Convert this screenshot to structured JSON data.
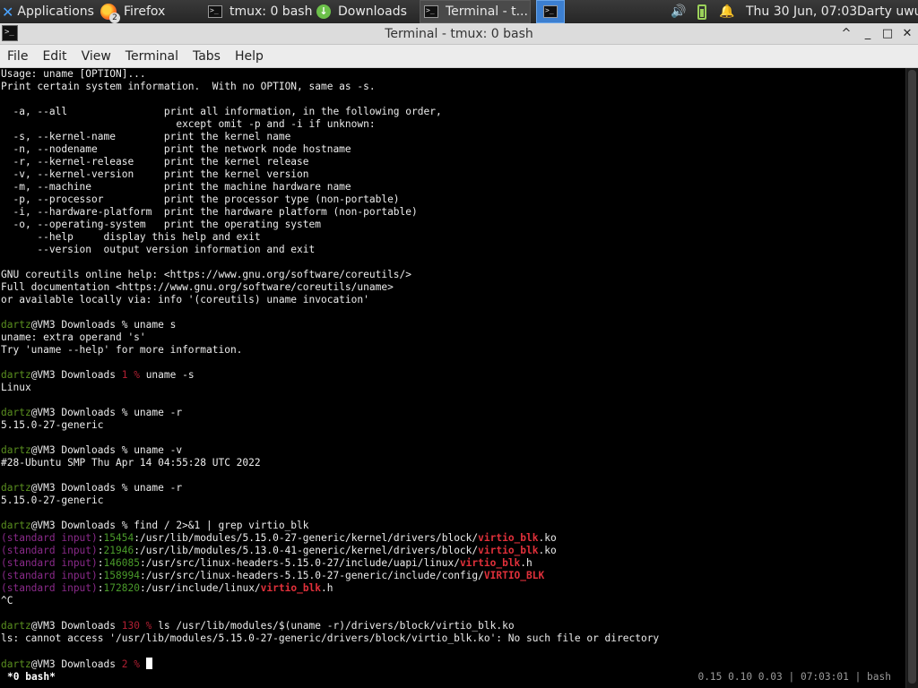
{
  "taskbar": {
    "applications": "Applications",
    "tasks": [
      {
        "label": "Firefox",
        "badge": "2"
      },
      {
        "label": "tmux: 0 bash"
      },
      {
        "label": "Downloads"
      },
      {
        "label": "Terminal - t..."
      }
    ],
    "clock": "Thu 30 Jun, 07:03",
    "user": "Darty uwu"
  },
  "window": {
    "title": "Terminal - tmux: 0 bash",
    "controls": {
      "shade": "^",
      "minimize": "_",
      "maximize": "□",
      "close": "✕"
    }
  },
  "menu": [
    "File",
    "Edit",
    "View",
    "Terminal",
    "Tabs",
    "Help"
  ],
  "terminal": {
    "lines": [
      [
        {
          "t": "Usage: uname [OPTION]..."
        }
      ],
      [
        {
          "t": "Print certain system information.  With no OPTION, same as -s."
        }
      ],
      [],
      [
        {
          "t": "  -a, --all                print all information, in the following order,"
        }
      ],
      [
        {
          "t": "                             except omit -p and -i if unknown:"
        }
      ],
      [
        {
          "t": "  -s, --kernel-name        print the kernel name"
        }
      ],
      [
        {
          "t": "  -n, --nodename           print the network node hostname"
        }
      ],
      [
        {
          "t": "  -r, --kernel-release     print the kernel release"
        }
      ],
      [
        {
          "t": "  -v, --kernel-version     print the kernel version"
        }
      ],
      [
        {
          "t": "  -m, --machine            print the machine hardware name"
        }
      ],
      [
        {
          "t": "  -p, --processor          print the processor type (non-portable)"
        }
      ],
      [
        {
          "t": "  -i, --hardware-platform  print the hardware platform (non-portable)"
        }
      ],
      [
        {
          "t": "  -o, --operating-system   print the operating system"
        }
      ],
      [
        {
          "t": "      --help     display this help and exit"
        }
      ],
      [
        {
          "t": "      --version  output version information and exit"
        }
      ],
      [],
      [
        {
          "t": "GNU coreutils online help: <https://www.gnu.org/software/coreutils/>"
        }
      ],
      [
        {
          "t": "Full documentation <https://www.gnu.org/software/coreutils/uname>"
        }
      ],
      [
        {
          "t": "or available locally via: info '(coreutils) uname invocation'"
        }
      ],
      [],
      [
        {
          "t": "dartz",
          "c": "user"
        },
        {
          "t": "@VM3 Downloads % uname s"
        }
      ],
      [
        {
          "t": "uname: extra operand 's'"
        }
      ],
      [
        {
          "t": "Try 'uname --help' for more information."
        }
      ],
      [],
      [
        {
          "t": "dartz",
          "c": "user"
        },
        {
          "t": "@VM3 Downloads "
        },
        {
          "t": "1 %",
          "c": "err"
        },
        {
          "t": " uname -s"
        }
      ],
      [
        {
          "t": "Linux"
        }
      ],
      [],
      [
        {
          "t": "dartz",
          "c": "user"
        },
        {
          "t": "@VM3 Downloads % uname -r"
        }
      ],
      [
        {
          "t": "5.15.0-27-generic"
        }
      ],
      [],
      [
        {
          "t": "dartz",
          "c": "user"
        },
        {
          "t": "@VM3 Downloads % uname -v"
        }
      ],
      [
        {
          "t": "#28-Ubuntu SMP Thu Apr 14 04:55:28 UTC 2022"
        }
      ],
      [],
      [
        {
          "t": "dartz",
          "c": "user"
        },
        {
          "t": "@VM3 Downloads % uname -r"
        }
      ],
      [
        {
          "t": "5.15.0-27-generic"
        }
      ],
      [],
      [
        {
          "t": "dartz",
          "c": "user"
        },
        {
          "t": "@VM3 Downloads % find / 2>&1 | grep virtio_blk"
        }
      ],
      [
        {
          "t": "(standard input)",
          "c": "purp"
        },
        {
          "t": ":"
        },
        {
          "t": "15454",
          "c": "grn"
        },
        {
          "t": ":/usr/lib/modules/5.15.0-27-generic/kernel/drivers/block/"
        },
        {
          "t": "virtio_blk",
          "c": "red"
        },
        {
          "t": ".ko"
        }
      ],
      [
        {
          "t": "(standard input)",
          "c": "purp"
        },
        {
          "t": ":"
        },
        {
          "t": "21946",
          "c": "grn"
        },
        {
          "t": ":/usr/lib/modules/5.13.0-41-generic/kernel/drivers/block/"
        },
        {
          "t": "virtio_blk",
          "c": "red"
        },
        {
          "t": ".ko"
        }
      ],
      [
        {
          "t": "(standard input)",
          "c": "purp"
        },
        {
          "t": ":"
        },
        {
          "t": "146085",
          "c": "grn"
        },
        {
          "t": ":/usr/src/linux-headers-5.15.0-27/include/uapi/linux/"
        },
        {
          "t": "virtio_blk",
          "c": "red"
        },
        {
          "t": ".h"
        }
      ],
      [
        {
          "t": "(standard input)",
          "c": "purp"
        },
        {
          "t": ":"
        },
        {
          "t": "158994",
          "c": "grn"
        },
        {
          "t": ":/usr/src/linux-headers-5.15.0-27-generic/include/config/"
        },
        {
          "t": "VIRTIO_BLK",
          "c": "red"
        }
      ],
      [
        {
          "t": "(standard input)",
          "c": "purp"
        },
        {
          "t": ":"
        },
        {
          "t": "172820",
          "c": "grn"
        },
        {
          "t": ":/usr/include/linux/"
        },
        {
          "t": "virtio_blk",
          "c": "red"
        },
        {
          "t": ".h"
        }
      ],
      [
        {
          "t": "^C"
        }
      ],
      [],
      [
        {
          "t": "dartz",
          "c": "user"
        },
        {
          "t": "@VM3 Downloads "
        },
        {
          "t": "130 %",
          "c": "err"
        },
        {
          "t": " ls /usr/lib/modules/$(uname -r)/drivers/block/virtio_blk.ko"
        }
      ],
      [
        {
          "t": "ls: cannot access '/usr/lib/modules/5.15.0-27-generic/drivers/block/virtio_blk.ko': No such file or directory"
        }
      ],
      [],
      [
        {
          "t": "dartz",
          "c": "user"
        },
        {
          "t": "@VM3 Downloads "
        },
        {
          "t": "2 %",
          "c": "err"
        },
        {
          "t": " "
        },
        {
          "cursor": true
        }
      ]
    ]
  },
  "tmux_status": {
    "left": "*0 bash*",
    "right": "0.15 0.10 0.03 | 07:03:01 | bash"
  }
}
